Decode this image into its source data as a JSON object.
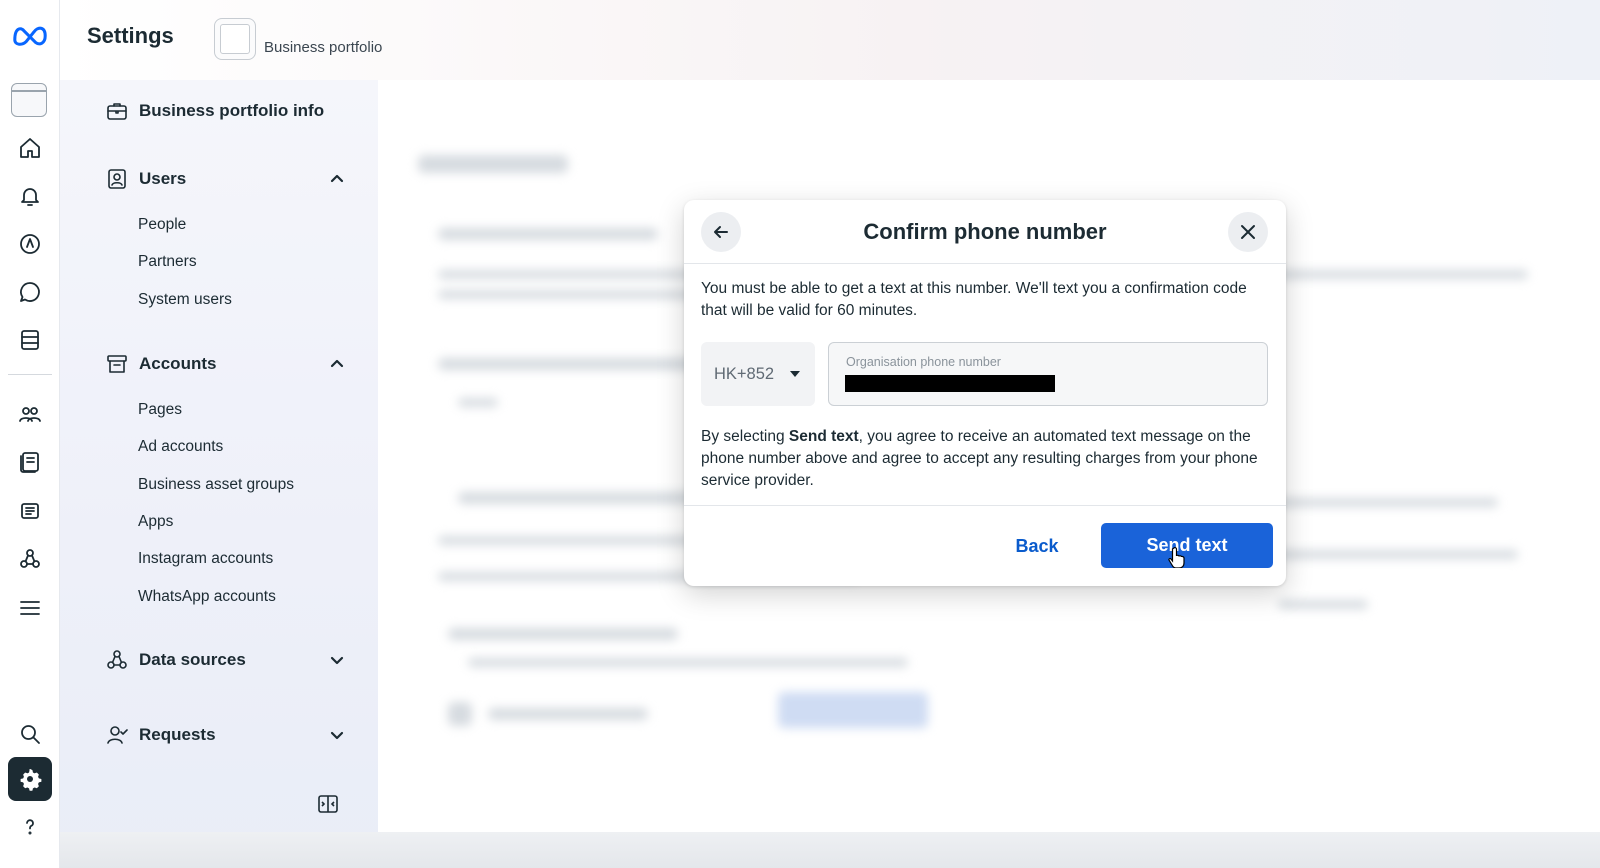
{
  "header": {
    "title": "Settings",
    "portfolio_name": "Business portfolio"
  },
  "rail": {
    "items": [
      {
        "icon": "meta-logo-icon"
      },
      {
        "icon": "business-portfolio-icon"
      },
      {
        "icon": "home-icon"
      },
      {
        "icon": "notifications-icon"
      },
      {
        "icon": "ads-icon"
      },
      {
        "icon": "messages-icon"
      },
      {
        "icon": "content-icon"
      },
      {
        "icon": "audience-icon"
      },
      {
        "icon": "catalogue-icon"
      },
      {
        "icon": "reports-icon"
      },
      {
        "icon": "data-sources-icon"
      },
      {
        "icon": "menu-icon"
      },
      {
        "icon": "search-icon"
      },
      {
        "icon": "settings-icon",
        "active": true
      },
      {
        "icon": "help-icon"
      }
    ]
  },
  "sidebar": {
    "portfolio_info": "Business portfolio info",
    "users": {
      "label": "Users",
      "items": [
        "People",
        "Partners",
        "System users"
      ]
    },
    "accounts": {
      "label": "Accounts",
      "items": [
        "Pages",
        "Ad accounts",
        "Business asset groups",
        "Apps",
        "Instagram accounts",
        "WhatsApp accounts"
      ]
    },
    "data_sources": "Data sources",
    "requests": "Requests"
  },
  "modal": {
    "title": "Confirm phone number",
    "description": "You must be able to get a text at this number. We'll text you a confirmation code that will be valid for 60 minutes.",
    "country_code": "HK+852",
    "phone_placeholder": "Organisation phone number",
    "consent_prefix": "By selecting ",
    "consent_bold": "Send text",
    "consent_suffix": ", you agree to receive an automated text message on the phone number above and agree to accept any resulting charges from your phone service provider.",
    "back_label": "Back",
    "send_label": "Send text"
  },
  "colors": {
    "primary": "#1a63d9",
    "link": "#0a5bcc",
    "text": "#1c2b33"
  }
}
